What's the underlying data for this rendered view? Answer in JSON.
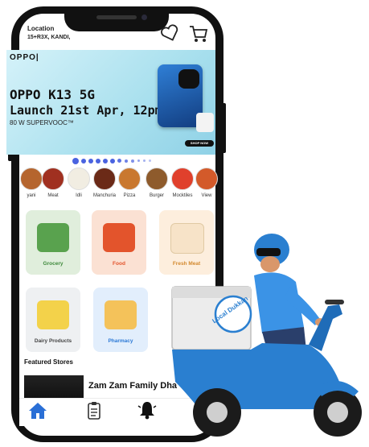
{
  "header": {
    "location_label": "Location",
    "address": "15+R3X, KANDI,"
  },
  "banner": {
    "brand": "OPPO|",
    "model": "OPPO K13 5G",
    "launch": "Launch 21st Apr, 12pm",
    "sub": "80 W SUPERVOOC™",
    "cta": "SHOP NOW"
  },
  "categories": [
    {
      "label": "yani",
      "color": "#b5652e"
    },
    {
      "label": "Meat",
      "color": "#a03020"
    },
    {
      "label": "Idli",
      "color": "#f1ede2"
    },
    {
      "label": "Manchuria",
      "color": "#6b2a17"
    },
    {
      "label": "Pizza",
      "color": "#c9782f"
    },
    {
      "label": "Burger",
      "color": "#8e5b2c"
    },
    {
      "label": "Mocktiles",
      "color": "#e0402c"
    },
    {
      "label": "View",
      "color": "#d35a2a"
    }
  ],
  "tiles": [
    {
      "label": "Grocery",
      "bg": "#e0eedc",
      "color": "#3f8a3c"
    },
    {
      "label": "Food",
      "bg": "#fbe1d3",
      "color": "#e3542c"
    },
    {
      "label": "Fresh Meat",
      "bg": "#fdeedd",
      "color": "#d3892f"
    },
    {
      "label": "Dairy Products",
      "bg": "#eef0f2",
      "color": "#444"
    },
    {
      "label": "Pharmacy",
      "bg": "#e2eefc",
      "color": "#2d7ad6"
    }
  ],
  "featured": {
    "title": "Featured Stores",
    "store_name": "Zam Zam Family Dha"
  },
  "brand_logo": {
    "text": "Local Dukkan"
  },
  "icons": [
    "heart-icon",
    "cart-icon",
    "home-icon",
    "orders-icon",
    "bell-icon"
  ]
}
